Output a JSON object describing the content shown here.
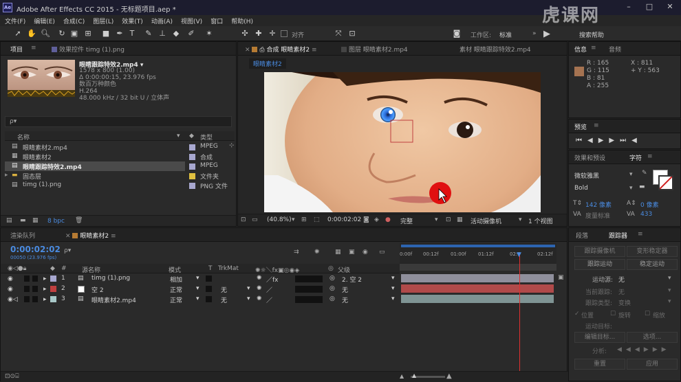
{
  "window": {
    "title": "Adobe After Effects CC 2015 - 无标题项目.aep *",
    "logo": "Ae",
    "watermark": "虎课网"
  },
  "menu": [
    "文件(F)",
    "编辑(E)",
    "合成(C)",
    "图层(L)",
    "效果(T)",
    "动画(A)",
    "视图(V)",
    "窗口",
    "帮助(H)"
  ],
  "toolbar": {
    "align_label": "对齐",
    "workspace_label": "工作区:",
    "workspace_value": "标准",
    "search_help": "搜索帮助"
  },
  "project": {
    "tab_project": "项目",
    "tab_effects": "效果控件 timg (1).png",
    "footage_name": "眼睛跟踪特效2.mp4 ▾",
    "footage_info": [
      "1578 x 800 (1.00)",
      "Δ 0:00:00:15, 23.976 fps",
      "数百万种颜色",
      "H.264",
      "48.000 kHz / 32 bit U / 立体声"
    ],
    "search_placeholder": "ρ▾",
    "col_name": "名称",
    "col_type": "类型",
    "items": [
      {
        "name": "眼睛素材2.mp4",
        "type": "MPEG",
        "color": "#a8a8d0"
      },
      {
        "name": "眼睛素材2",
        "type": "合成",
        "color": "#a8a8d0"
      },
      {
        "name": "眼睛跟踪特效2.mp4",
        "type": "MPEG",
        "color": "#a8a8d0"
      },
      {
        "name": "固态层",
        "type": "文件夹",
        "color": "#e0c040"
      },
      {
        "name": "timg (1).png",
        "type": "PNG 文件",
        "color": "#a8a8d0"
      }
    ],
    "bpc": "8 bpc"
  },
  "viewer": {
    "tab_comp": "合成 眼睛素材2",
    "tab_layer": "图层 眼睛素材2.mp4",
    "tab_footage": "素材 眼睛跟踪特效2.mp4",
    "crumb": "眼睛素材2",
    "zoom": "(40.8%)",
    "time": "0:00:02:02",
    "quality": "完整",
    "camera": "活动摄像机",
    "views": "1 个视图"
  },
  "info": {
    "tab_info": "信息",
    "tab_audio": "音频",
    "r": "R : 165",
    "g": "G : 115",
    "b": "B : 81",
    "a": "A : 255",
    "x": "X : 811",
    "y": "+ Y : 563",
    "swatch": "#a57351"
  },
  "preview": {
    "title": "预览"
  },
  "character": {
    "tab_effects": "效果和预设",
    "tab_char": "字符",
    "font": "微软雅黑",
    "style": "Bold",
    "size": "142 像素",
    "kerning": "度量标准",
    "tracking": "433",
    "leading": "0 像素"
  },
  "tracker": {
    "tab_para": "段落",
    "tab_tracker": "跟踪器",
    "btn_camera": "跟踪摄像机",
    "btn_warp": "变形稳定器",
    "btn_motion": "跟踪运动",
    "btn_stab": "稳定运动",
    "source_label": "运动源:",
    "source_val": "无",
    "current_label": "当前跟踪:",
    "current_val": "无",
    "type_label": "跟踪类型:",
    "type_val": "变换",
    "cb_pos": "位置",
    "cb_rot": "旋转",
    "cb_scale": "缩放",
    "target_label": "运动目标:",
    "edit_target": "编辑目标...",
    "options": "选项...",
    "analyze": "分析:",
    "reset": "重置",
    "apply": "应用"
  },
  "timeline": {
    "tab_render": "渲染队列",
    "tab_comp": "眼睛素材2",
    "timecode": "0:00:02:02",
    "timecode_sub": "00050 (23.976 fps)",
    "col_name": "源名称",
    "col_mode": "模式",
    "col_t": "T",
    "col_trkmat": "TrkMat",
    "col_parent": "父级",
    "ruler": [
      "0:00f",
      "00:12f",
      "01:00f",
      "01:12f",
      "02:0",
      "02:12f"
    ],
    "layers": [
      {
        "num": "1",
        "name": "timg (1).png",
        "mode": "相加",
        "trkmat": "",
        "parent": "2. 空 2",
        "color": "#a8a8d0",
        "bar": "#8f8f9c"
      },
      {
        "num": "2",
        "name": "空 2",
        "mode": "正常",
        "trkmat": "无",
        "parent": "无",
        "color": "#c04040",
        "bar": "#b04a4a"
      },
      {
        "num": "3",
        "name": "眼睛素材2.mp4",
        "mode": "正常",
        "trkmat": "无",
        "parent": "无",
        "color": "#a8c8c8",
        "bar": "#7f9494"
      }
    ]
  }
}
